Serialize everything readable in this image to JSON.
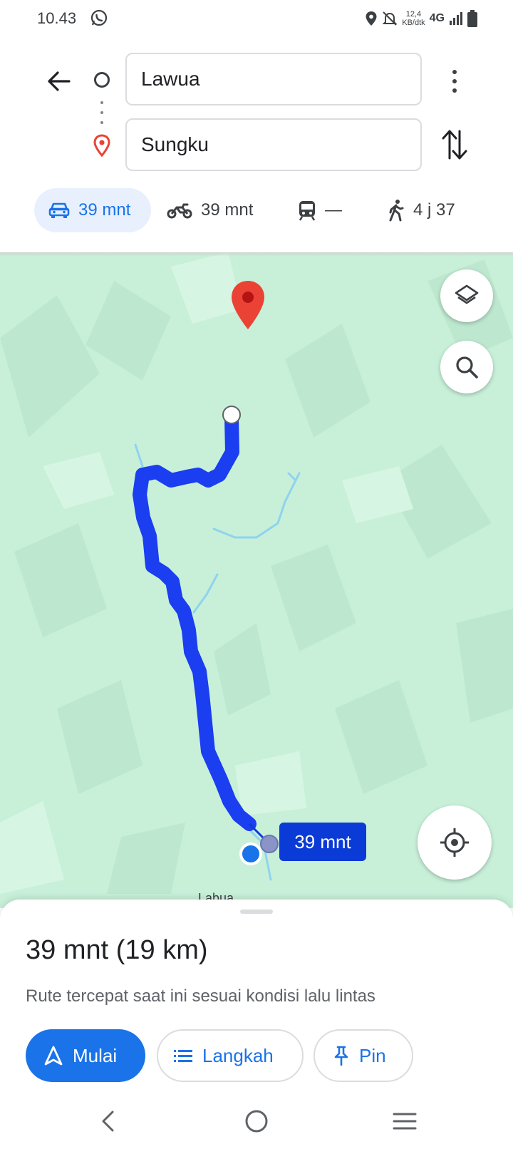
{
  "status_bar": {
    "time": "10.43",
    "speed_value": "12,4",
    "speed_unit": "KB/dtk",
    "network": "4G",
    "icons": [
      "whatsapp-icon",
      "location-icon",
      "notifications-off-icon",
      "signal-icon",
      "battery-icon"
    ]
  },
  "directions": {
    "origin": "Lawua",
    "destination": "Sungku",
    "modes": [
      {
        "id": "car",
        "icon": "car-icon",
        "label": "39 mnt",
        "selected": true
      },
      {
        "id": "motorcycle",
        "icon": "motorcycle-icon",
        "label": "39 mnt",
        "selected": false
      },
      {
        "id": "transit",
        "icon": "train-icon",
        "label": "—",
        "selected": false
      },
      {
        "id": "walk",
        "icon": "walk-icon",
        "label": "4 j 37",
        "selected": false
      }
    ]
  },
  "map": {
    "route_duration_tag": "39 mnt",
    "town_label": "Labua",
    "route_color": "#1a3ef0",
    "destination_pin_color": "#ea4335",
    "land_color": "#c8f0d9"
  },
  "sheet": {
    "summary": "39 mnt (19 km)",
    "subtitle": "Rute tercepat saat ini sesuai kondisi lalu lintas",
    "start_label": "Mulai",
    "steps_label": "Langkah",
    "pin_label": "Pin"
  },
  "colors": {
    "accent": "#1a73e8",
    "accent_light": "#e8f0fe"
  }
}
